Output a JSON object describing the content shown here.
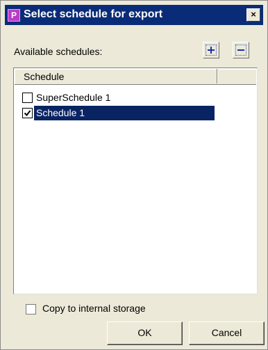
{
  "window": {
    "title": "Select schedule for export",
    "app_icon_letter": "P",
    "close_symbol": "×"
  },
  "toolbar": {
    "available_label": "Available schedules:",
    "add_icon": "plus-icon",
    "remove_icon": "minus-icon"
  },
  "list": {
    "columns": [
      "Schedule",
      ""
    ],
    "items": [
      {
        "label": "SuperSchedule 1",
        "checked": false,
        "selected": false
      },
      {
        "label": "Schedule 1",
        "checked": true,
        "selected": true
      }
    ]
  },
  "footer": {
    "copy_label": "Copy to internal storage",
    "copy_checked": false,
    "ok_label": "OK",
    "cancel_label": "Cancel"
  },
  "colors": {
    "titlebar": "#0a2c78",
    "selection": "#0a2463",
    "face": "#ece9d8"
  }
}
